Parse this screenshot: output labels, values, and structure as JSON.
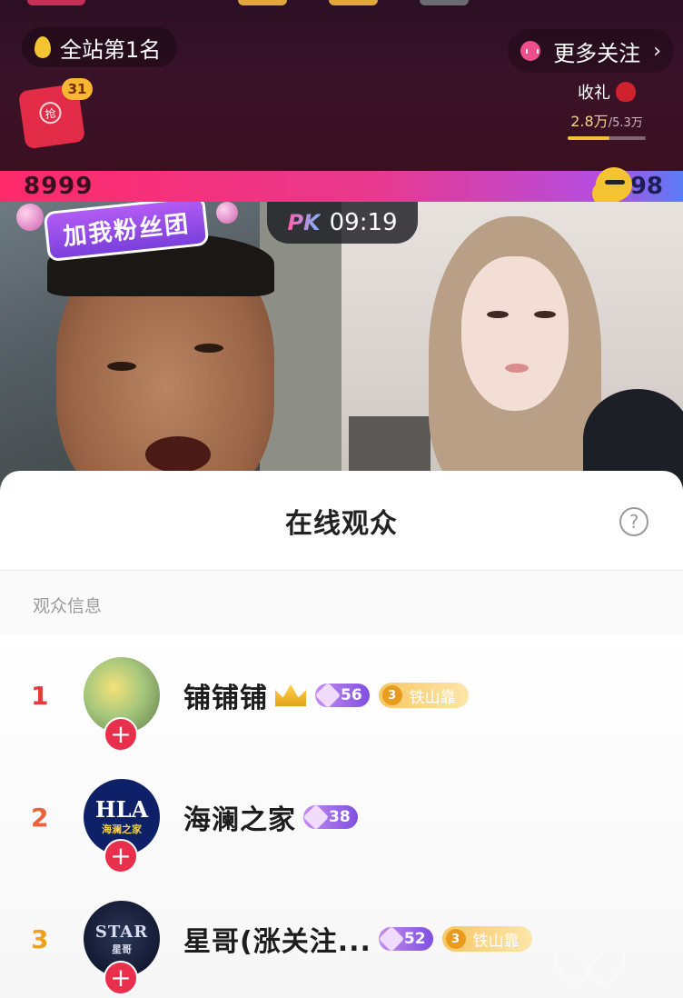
{
  "header": {
    "rank_text": "全站第1名",
    "follow_label": "更多关注",
    "redpacket_badge": "31",
    "redpacket_seal": "抢",
    "gift_title": "收礼",
    "gift_current": "2.8万",
    "gift_total": "/5.3万",
    "gift_progress": 0.53
  },
  "pk": {
    "left_score": "8999",
    "right_score": "98",
    "timer_logo": "PK",
    "timer": "09:19",
    "fan_club_sign": "加我粉丝团"
  },
  "sheet": {
    "title": "在线观众",
    "help_icon": "?",
    "section_label": "观众信息"
  },
  "audience": [
    {
      "rank": "1",
      "name": "铺铺铺",
      "crown": true,
      "level": "56",
      "fan_level": "3",
      "fan_club": "铁山靠"
    },
    {
      "rank": "2",
      "name": "海澜之家",
      "crown": false,
      "level": "38",
      "avatar_text": "HLA",
      "avatar_sub": "海澜之家"
    },
    {
      "rank": "3",
      "name": "星哥(涨关注...",
      "crown": false,
      "level": "52",
      "fan_level": "3",
      "fan_club": "铁山靠",
      "avatar_text": "STAR",
      "avatar_sub": "星哥"
    }
  ],
  "colors": {
    "rank1": "#e03c3c",
    "rank2": "#e8623a",
    "rank3": "#f0a020",
    "accent_red": "#e8304c"
  }
}
